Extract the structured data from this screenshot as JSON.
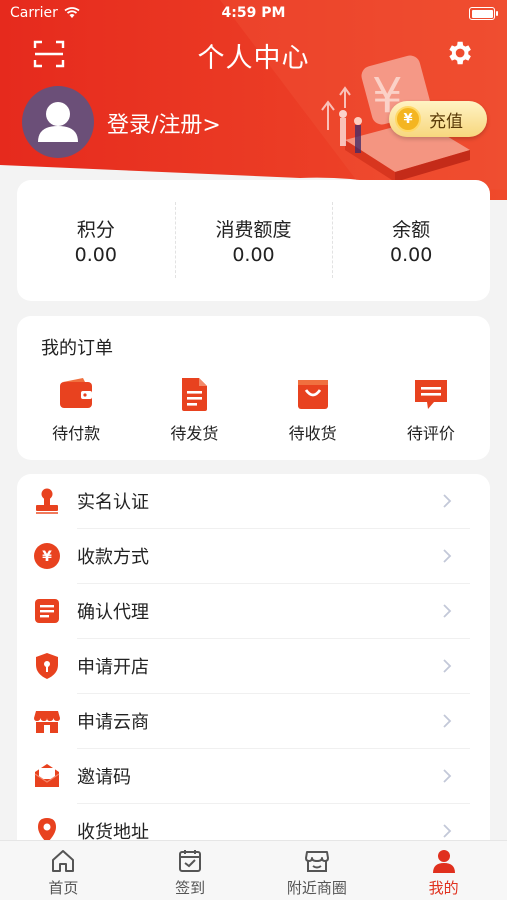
{
  "status_bar": {
    "carrier": "Carrier",
    "time": "4:59 PM"
  },
  "header": {
    "title": "个人中心",
    "login_text": "登录/注册>",
    "recharge_label": "充值",
    "coin_symbol": "¥",
    "brand_color": "#e8321f"
  },
  "stats": [
    {
      "label": "积分",
      "value": "0.00"
    },
    {
      "label": "消费额度",
      "value": "0.00"
    },
    {
      "label": "余额",
      "value": "0.00"
    }
  ],
  "orders": {
    "title": "我的订单",
    "items": [
      {
        "label": "待付款",
        "icon": "wallet-icon"
      },
      {
        "label": "待发货",
        "icon": "document-icon"
      },
      {
        "label": "待收货",
        "icon": "bag-icon"
      },
      {
        "label": "待评价",
        "icon": "comment-icon"
      }
    ]
  },
  "menu": [
    {
      "label": "实名认证",
      "icon": "stamp-icon"
    },
    {
      "label": "收款方式",
      "icon": "yuan-coin-icon"
    },
    {
      "label": "确认代理",
      "icon": "list-doc-icon"
    },
    {
      "label": "申请开店",
      "icon": "shield-icon"
    },
    {
      "label": "申请云商",
      "icon": "store-icon"
    },
    {
      "label": "邀请码",
      "icon": "envelope-icon"
    },
    {
      "label": "收货地址",
      "icon": "location-icon"
    }
  ],
  "tabbar": [
    {
      "label": "首页",
      "icon": "home-icon",
      "active": false
    },
    {
      "label": "签到",
      "icon": "calendar-check-icon",
      "active": false
    },
    {
      "label": "附近商圈",
      "icon": "shop-icon",
      "active": false
    },
    {
      "label": "我的",
      "icon": "user-icon",
      "active": true
    }
  ]
}
